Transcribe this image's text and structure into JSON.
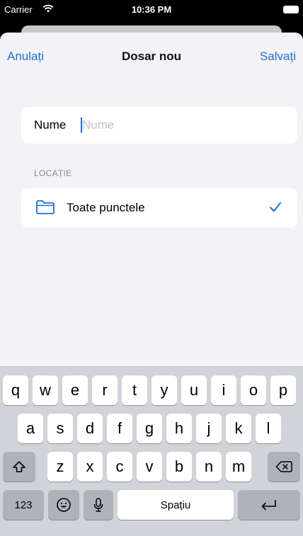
{
  "status_bar": {
    "carrier": "Carrier",
    "time": "10:36 PM"
  },
  "nav": {
    "cancel_label": "Anulați",
    "title": "Dosar nou",
    "save_label": "Salvați"
  },
  "form": {
    "name_label": "Nume",
    "name_placeholder": "Nume",
    "name_value": ""
  },
  "location": {
    "section_header": "LOCAȚIE",
    "selected_label": "Toate punctele",
    "icon": "folder-icon",
    "selected_icon": "checkmark-icon"
  },
  "keyboard": {
    "row1": [
      "q",
      "w",
      "e",
      "r",
      "t",
      "y",
      "u",
      "i",
      "o",
      "p"
    ],
    "row2": [
      "a",
      "s",
      "d",
      "f",
      "g",
      "h",
      "j",
      "k",
      "l"
    ],
    "row3": [
      "z",
      "x",
      "c",
      "v",
      "b",
      "n",
      "m"
    ],
    "numbers_label": "123",
    "space_label": "Spațiu"
  },
  "colors": {
    "accent": "#1f6fd6",
    "background": "#f2f2f7",
    "keyboard": "#d1d3d9"
  }
}
